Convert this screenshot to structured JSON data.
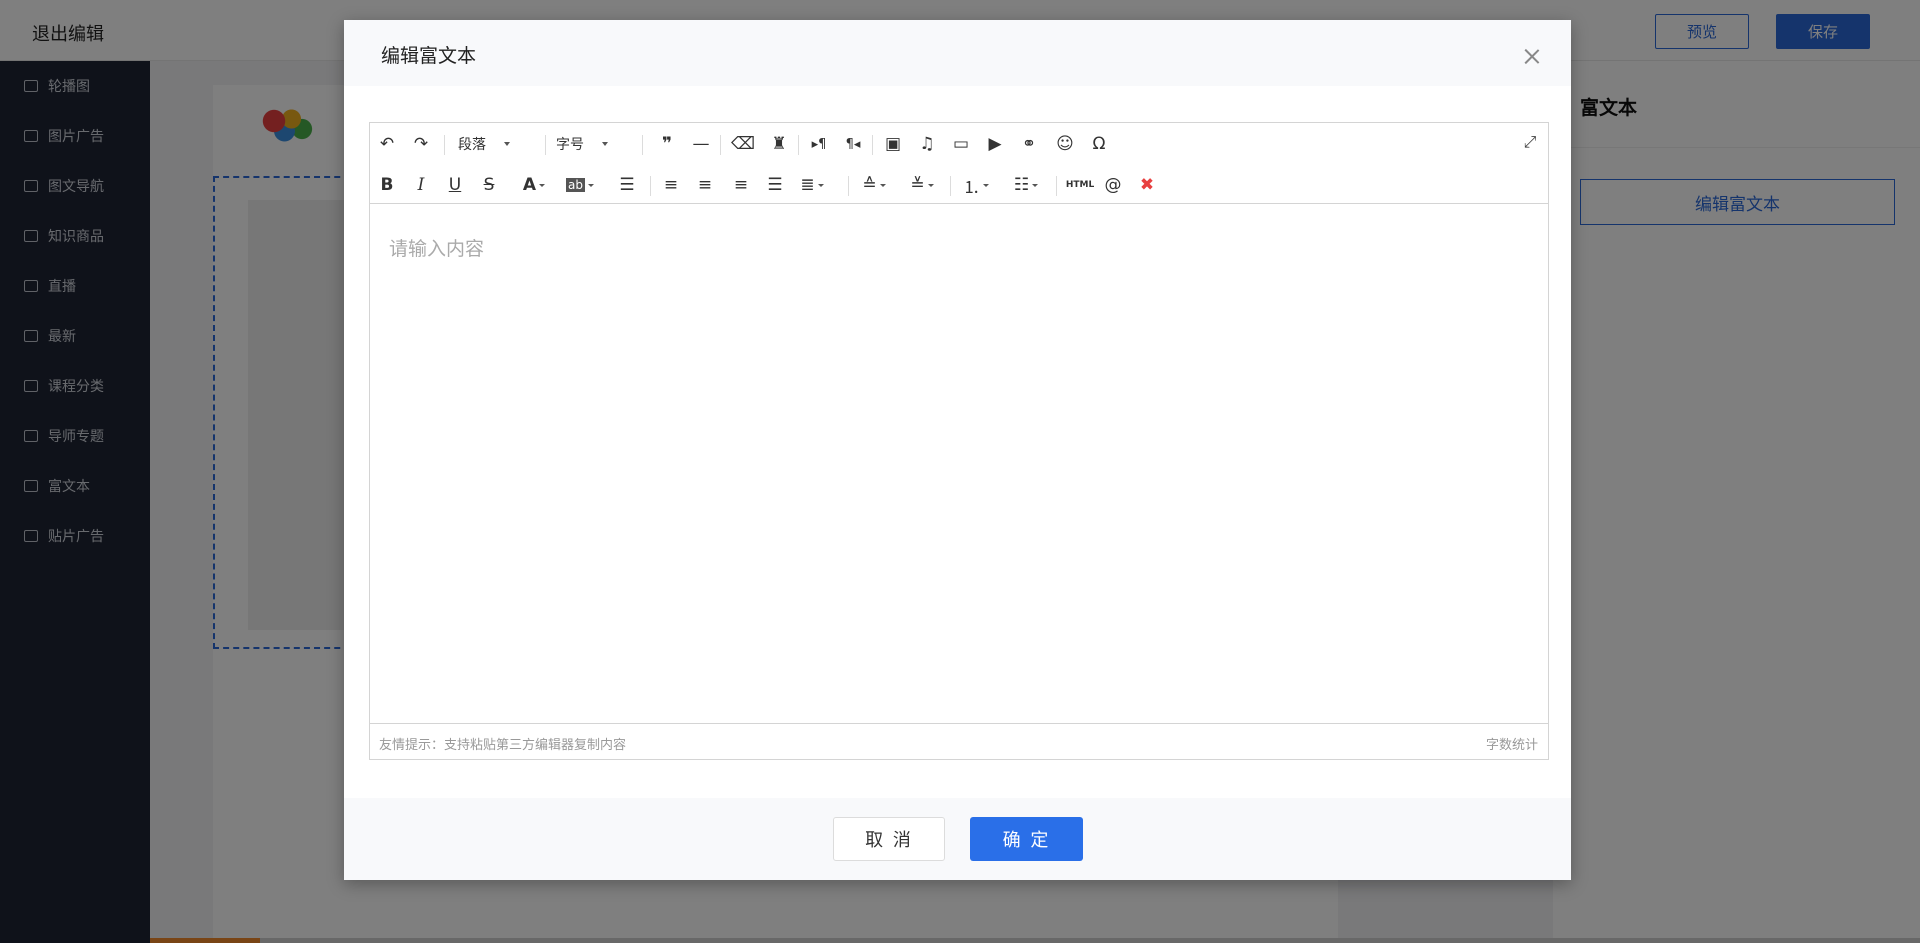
{
  "topbar": {
    "exit_label": "退出编辑",
    "preview_label": "预览",
    "save_label": "保存"
  },
  "sidebar": {
    "items": [
      {
        "label": "轮播图",
        "icon": "carousel-icon"
      },
      {
        "label": "图片广告",
        "icon": "image-ad-icon"
      },
      {
        "label": "图文导航",
        "icon": "nav-icon"
      },
      {
        "label": "知识商品",
        "icon": "product-icon"
      },
      {
        "label": "直播",
        "icon": "live-icon"
      },
      {
        "label": "最新",
        "icon": "latest-icon"
      },
      {
        "label": "课程分类",
        "icon": "category-icon"
      },
      {
        "label": "导师专题",
        "icon": "mentor-icon"
      },
      {
        "label": "富文本",
        "icon": "richtext-icon"
      },
      {
        "label": "贴片广告",
        "icon": "patch-ad-icon"
      }
    ]
  },
  "right_panel": {
    "title": "富文本",
    "edit_button_label": "编辑富文本"
  },
  "modal": {
    "title": "编辑富文本",
    "toolbar": {
      "paragraph_label": "段落",
      "fontsize_label": "字号",
      "html_label": "HTML"
    },
    "editor_placeholder": "请输入内容",
    "status_tip": "友情提示：支持粘贴第三方编辑器复制内容",
    "word_count_label": "字数统计",
    "cancel_label": "取 消",
    "confirm_label": "确 定"
  },
  "colors": {
    "primary": "#2a68d8",
    "confirm": "#2a6fe8",
    "sidebar_bg": "#1f2535"
  }
}
